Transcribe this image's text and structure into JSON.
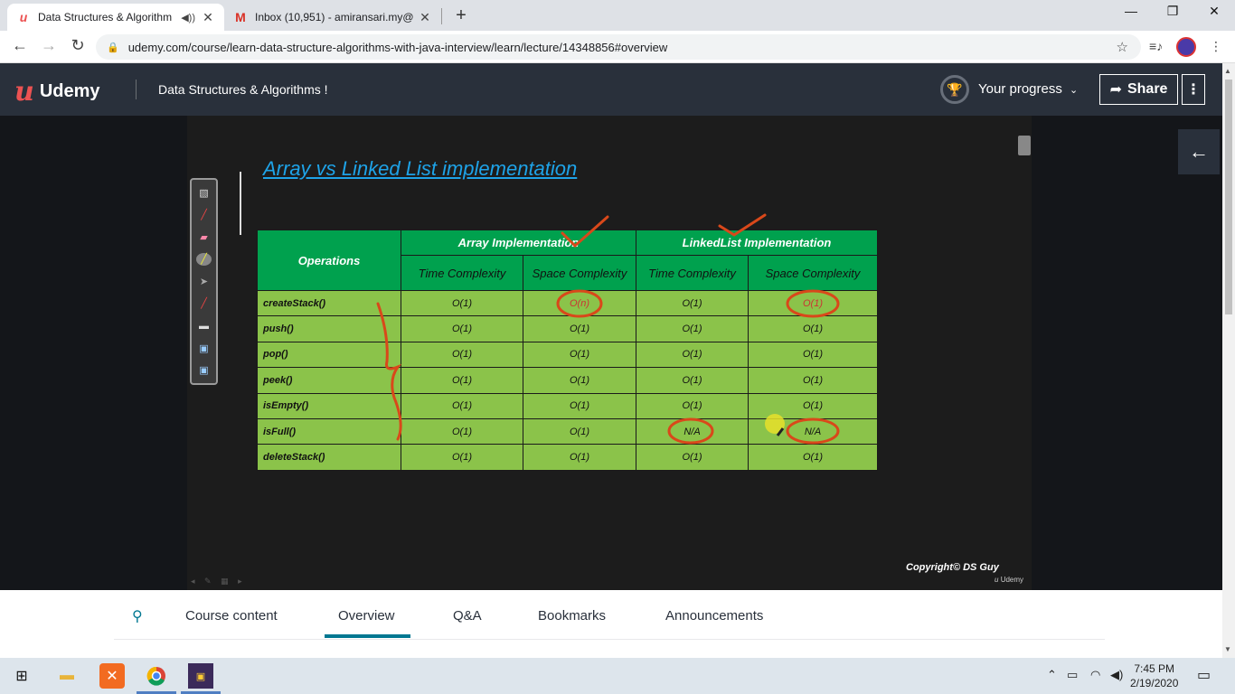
{
  "browser": {
    "tabs": [
      {
        "title": "Data Structures & Algorithm",
        "favicon": "udemy-icon",
        "active": true
      },
      {
        "title": "Inbox (10,951) - amiransari.my@",
        "favicon": "gmail-icon",
        "active": false
      }
    ],
    "new_tab": "+",
    "url": "udemy.com/course/learn-data-structure-algorithms-with-java-interview/learn/lecture/14348856#overview"
  },
  "header": {
    "logo_text": "Udemy",
    "course_title": "Data Structures & Algorithms !",
    "progress_label": "Your progress",
    "share_label": "Share"
  },
  "slide": {
    "title": "Array vs Linked List implementation",
    "copyright": "Copyright© DS Guy",
    "watermark": "Udemy",
    "table": {
      "operations_header": "Operations",
      "array_header": "Array Implementation",
      "linkedlist_header": "LinkedList  Implementation",
      "sub_headers": [
        "Time Complexity",
        "Space Complexity",
        "Time Complexity",
        "Space Complexity"
      ],
      "rows": [
        {
          "op": "createStack()",
          "arr_time": "O(1)",
          "arr_space": "O(n)",
          "ll_time": "O(1)",
          "ll_space": "O(1)"
        },
        {
          "op": "push()",
          "arr_time": "O(1)",
          "arr_space": "O(1)",
          "ll_time": "O(1)",
          "ll_space": "O(1)"
        },
        {
          "op": "pop()",
          "arr_time": "O(1)",
          "arr_space": "O(1)",
          "ll_time": "O(1)",
          "ll_space": "O(1)"
        },
        {
          "op": "peek()",
          "arr_time": "O(1)",
          "arr_space": "O(1)",
          "ll_time": "O(1)",
          "ll_space": "O(1)"
        },
        {
          "op": "isEmpty()",
          "arr_time": "O(1)",
          "arr_space": "O(1)",
          "ll_time": "O(1)",
          "ll_space": "O(1)"
        },
        {
          "op": "isFull()",
          "arr_time": "O(1)",
          "arr_space": "O(1)",
          "ll_time": "N/A",
          "ll_space": "N/A"
        },
        {
          "op": "deleteStack()",
          "arr_time": "O(1)",
          "arr_space": "O(1)",
          "ll_time": "O(1)",
          "ll_space": "O(1)"
        }
      ]
    },
    "annotation_color": "#e0401a"
  },
  "course_tabs": {
    "items": [
      "Course content",
      "Overview",
      "Q&A",
      "Bookmarks",
      "Announcements"
    ],
    "active": "Overview"
  },
  "taskbar": {
    "time": "7:45 PM",
    "date": "2/19/2020"
  },
  "colors": {
    "header_bg": "#29303b",
    "table_header": "#00a14e",
    "table_cell": "#8bc34a",
    "title_blue": "#1ea3e8",
    "accent_teal": "#007791"
  }
}
